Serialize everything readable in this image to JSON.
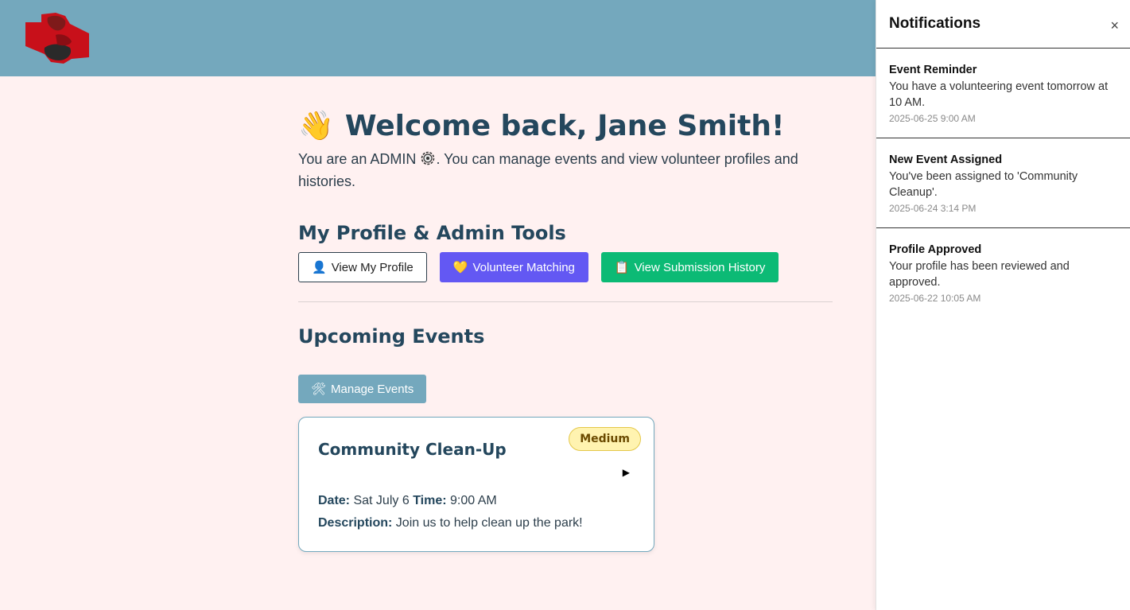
{
  "welcome": {
    "wave_icon": "👋",
    "title": "Welcome back, Jane Smith!",
    "role_prefix": "You are an ADMIN",
    "role_suffix": ". You can manage events and view volunteer profiles and histories."
  },
  "profile_tools": {
    "title": "My Profile & Admin Tools",
    "buttons": [
      {
        "icon": "👤",
        "label": "View My Profile"
      },
      {
        "icon": "💛",
        "label": "Volunteer Matching"
      },
      {
        "icon": "📋",
        "label": "View Submission History"
      }
    ]
  },
  "events": {
    "title": "Upcoming Events",
    "manage_icon": "🛠",
    "manage_label": "Manage Events",
    "items": [
      {
        "name": "Community Clean-Up",
        "urgency": "Medium",
        "date_label": "Date:",
        "date": "Sat July 6",
        "time_label": "Time:",
        "time": "9:00 AM",
        "description_label": "Description:",
        "description": "Join us to help clean up the park!"
      }
    ]
  },
  "notifications": {
    "title": "Notifications",
    "close_label": "×",
    "items": [
      {
        "title": "Event Reminder",
        "message": "You have a volunteering event tomorrow at 10 AM.",
        "time": "2025-06-25 9:00 AM"
      },
      {
        "title": "New Event Assigned",
        "message": "You've been assigned to 'Community Cleanup'.",
        "time": "2025-06-24 3:14 PM"
      },
      {
        "title": "Profile Approved",
        "message": "Your profile has been reviewed and approved.",
        "time": "2025-06-22 10:05 AM"
      }
    ]
  },
  "colors": {
    "header": "#74a8bd",
    "page_bg": "#fff1f1",
    "purple_button": "#6358f3",
    "green_button": "#0cba75",
    "badge_bg": "#fff3b0"
  }
}
